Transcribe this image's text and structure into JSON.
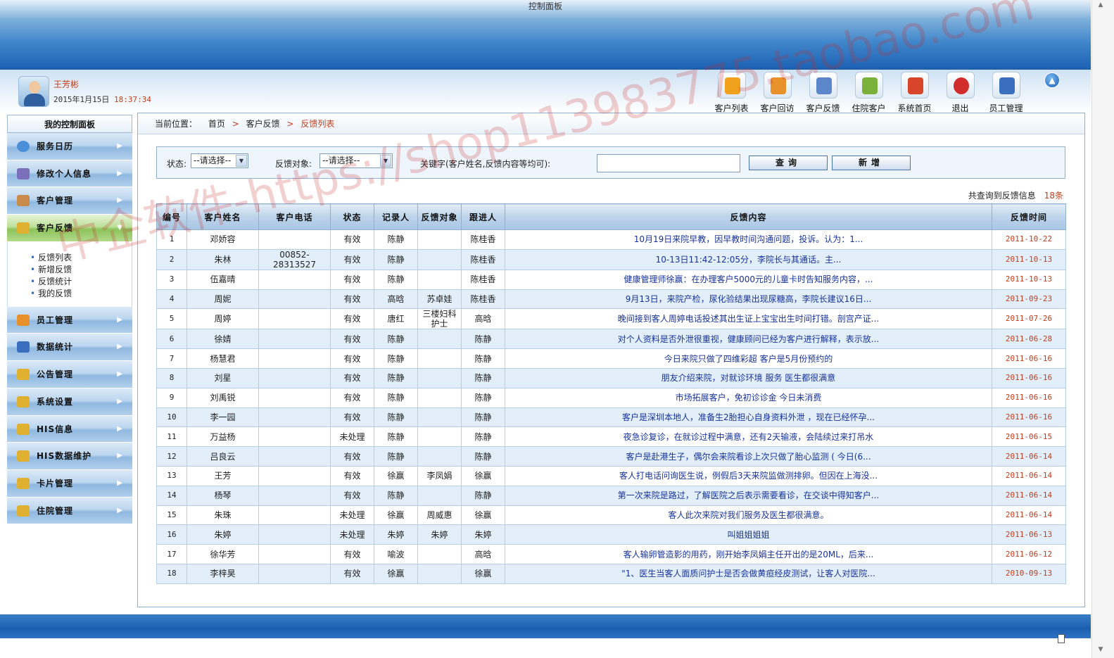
{
  "window_title": "控制面板",
  "user": {
    "name": "王芳彬",
    "date": "2015年1月15日",
    "time": "18:37:34"
  },
  "toolbar": [
    {
      "label": "客户列表",
      "icon": "people-icon",
      "color": "#f2a11c"
    },
    {
      "label": "客户回访",
      "icon": "user-visit-icon",
      "color": "#e8902a"
    },
    {
      "label": "客户反馈",
      "icon": "group-feedback-icon",
      "color": "#5b86c9"
    },
    {
      "label": "住院客户",
      "icon": "edit-pencil-icon",
      "color": "#79b13a"
    },
    {
      "label": "系统首页",
      "icon": "home-icon",
      "color": "#d9452b"
    },
    {
      "label": "退出",
      "icon": "close-icon",
      "color": "#d22d2d"
    },
    {
      "label": "员工管理",
      "icon": "staff-icon",
      "color": "#3a6fbf"
    }
  ],
  "sidebar": {
    "title": "我的控制面板",
    "items": [
      {
        "label": "服务日历",
        "icon": "clock-icon",
        "color": "#4a8fd8"
      },
      {
        "label": "修改个人信息",
        "icon": "person-icon",
        "color": "#7a6fb8"
      },
      {
        "label": "客户管理",
        "icon": "customer-icon",
        "color": "#c98b4a"
      },
      {
        "label": "客户反馈",
        "icon": "feedback-icon",
        "color": "#e0b030",
        "active": true
      },
      {
        "label": "员工管理",
        "icon": "staff-icon",
        "color": "#e8902a"
      },
      {
        "label": "数据统计",
        "icon": "monitor-icon",
        "color": "#3a6fbf"
      },
      {
        "label": "公告管理",
        "icon": "folder-icon",
        "color": "#e0b030"
      },
      {
        "label": "系统设置",
        "icon": "folder-icon",
        "color": "#e0b030"
      },
      {
        "label": "HIS信息",
        "icon": "folder-icon",
        "color": "#e0b030"
      },
      {
        "label": "HIS数据维护",
        "icon": "folder-icon",
        "color": "#e0b030"
      },
      {
        "label": "卡片管理",
        "icon": "folder-icon",
        "color": "#e0b030"
      },
      {
        "label": "住院管理",
        "icon": "folder-icon",
        "color": "#e0b030"
      }
    ],
    "submenu": [
      "反馈列表",
      "新增反馈",
      "反馈统计",
      "我的反馈"
    ]
  },
  "breadcrumb": {
    "label": "当前位置：",
    "home": "首页",
    "section": "客户反馈",
    "current": "反馈列表",
    "separator": ">"
  },
  "filters": {
    "status_label": "状态:",
    "status_value": "--请选择--",
    "target_label": "反馈对象:",
    "target_value": "--请选择--",
    "keyword_label": "关键字(客户姓名,反馈内容等均可):",
    "keyword_value": "",
    "search_button": "查询",
    "add_button": "新增"
  },
  "result": {
    "label": "共查询到反馈信息",
    "count": "18条"
  },
  "table": {
    "columns": [
      "编号",
      "客户姓名",
      "客户电话",
      "状态",
      "记录人",
      "反馈对象",
      "跟进人",
      "反馈内容",
      "反馈时间"
    ],
    "rows": [
      [
        "1",
        "邓娇容",
        "",
        "有效",
        "陈静",
        "",
        "陈桂香",
        "10月19日来院早教，因早教时间沟通问题，投诉。认为：1...",
        "2011-10-22"
      ],
      [
        "2",
        "朱林",
        "00852-28313527",
        "有效",
        "陈静",
        "",
        "陈桂香",
        "10-13日11:42-12:05分，李院长与其通话。主...",
        "2011-10-13"
      ],
      [
        "3",
        "伍嘉晴",
        "",
        "有效",
        "陈静",
        "",
        "陈桂香",
        "健康管理师徐赢：在办理客户5000元的儿童卡时告知服务内容，...",
        "2011-10-13"
      ],
      [
        "4",
        "周妮",
        "",
        "有效",
        "高晗",
        "苏卓娃",
        "陈桂香",
        "9月13日，来院产检，尿化验结果出现尿糖高，李院长建议16日...",
        "2011-09-23"
      ],
      [
        "5",
        "周婷",
        "",
        "有效",
        "唐红",
        "三楼妇科护士",
        "高晗",
        "晚间接到客人周婷电话投述其出生证上宝宝出生时间打错。剖宫产证...",
        "2011-07-26"
      ],
      [
        "6",
        "徐婧",
        "",
        "有效",
        "陈静",
        "",
        "陈静",
        "对个人资料是否外泄很重视，健康顾问已经为客户进行解释，表示放...",
        "2011-06-28"
      ],
      [
        "7",
        "杨慧君",
        "",
        "有效",
        "陈静",
        "",
        "陈静",
        "今日来院只做了四维彩超 客户是5月份预约的",
        "2011-06-16"
      ],
      [
        "8",
        "刘星",
        "",
        "有效",
        "陈静",
        "",
        "陈静",
        "朋友介绍来院，对就诊环境 服务 医生都很满意",
        "2011-06-16"
      ],
      [
        "9",
        "刘禹锐",
        "",
        "有效",
        "陈静",
        "",
        "陈静",
        "市场拓展客户，免初诊诊金 今日未消费",
        "2011-06-16"
      ],
      [
        "10",
        "李一园",
        "",
        "有效",
        "陈静",
        "",
        "陈静",
        "客户是深圳本地人，准备生2胎担心自身资料外泄 ，现在已经怀孕...",
        "2011-06-16"
      ],
      [
        "11",
        "万益杨",
        "",
        "未处理",
        "陈静",
        "",
        "陈静",
        "夜急诊复诊，在就诊过程中满意，还有2天输液，会陆续过来打吊水",
        "2011-06-15"
      ],
      [
        "12",
        "吕良云",
        "",
        "有效",
        "陈静",
        "",
        "陈静",
        "客户是赴港生子，偶尔会来院看诊上次只做了胎心监测 ( 今日(6...",
        "2011-06-14"
      ],
      [
        "13",
        "王芳",
        "",
        "有效",
        "徐赢",
        "李凤娟",
        "徐赢",
        "客人打电话问询医生说，例假后3天来院监做测排卵。但因在上海没...",
        "2011-06-14"
      ],
      [
        "14",
        "杨琴",
        "",
        "有效",
        "陈静",
        "",
        "陈静",
        "第一次来院是路过，了解医院之后表示需要看诊，在交谈中得知客户...",
        "2011-06-14"
      ],
      [
        "15",
        "朱珠",
        "",
        "未处理",
        "徐赢",
        "周威惠",
        "徐赢",
        "客人此次来院对我们服务及医生都很满意。",
        "2011-06-14"
      ],
      [
        "16",
        "朱婷",
        "",
        "未处理",
        "朱婷",
        "朱婷",
        "朱婷",
        "叫姐姐姐姐",
        "2011-06-13"
      ],
      [
        "17",
        "徐华芳",
        "",
        "有效",
        "喻波",
        "",
        "高晗",
        "客人输卵管造影的用药，刚开始李凤娟主任开出的是20ML，后来...",
        "2011-06-12"
      ],
      [
        "18",
        "李梓昊",
        "",
        "有效",
        "徐赢",
        "",
        "徐赢",
        "\"1、医生当客人面质问护士是否会做黄疸经皮测试，让客人对医院...",
        "2010-09-13"
      ]
    ]
  },
  "watermark": "中企软件-https://shop113983775.taobao.com"
}
